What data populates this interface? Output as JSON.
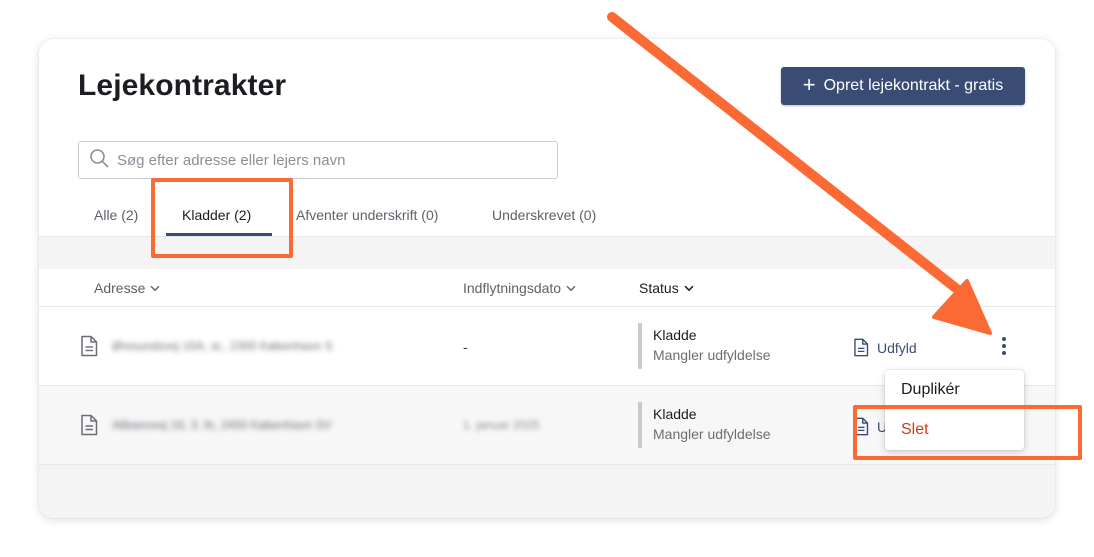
{
  "header": {
    "title": "Lejekontrakter",
    "create_button_label": "Opret lejekontrakt - gratis"
  },
  "search": {
    "placeholder": "Søg efter adresse eller lejers navn",
    "value": ""
  },
  "tabs": [
    {
      "label": "Alle (2)",
      "active": false
    },
    {
      "label": "Kladder (2)",
      "active": true
    },
    {
      "label": "Afventer underskrift (0)",
      "active": false
    },
    {
      "label": "Underskrevet (0)",
      "active": false
    }
  ],
  "table": {
    "columns": [
      {
        "label": "Adresse"
      },
      {
        "label": "Indflytningsdato"
      },
      {
        "label": "Status"
      }
    ],
    "rows": [
      {
        "address": "Øresundsvej 15A, st., 2300 København S",
        "move_in_date": "-",
        "status": "Kladde",
        "status_detail": "Mangler udfyldelse",
        "action_label": "Udfyld"
      },
      {
        "address": "Allbanovej 16, 3. th, 2450 København SV",
        "move_in_date": "1. januar 2025",
        "status": "Kladde",
        "status_detail": "Mangler udfyldelse",
        "action_label": "Udfyld"
      }
    ]
  },
  "row_menu": {
    "items": [
      {
        "label": "Duplikér"
      },
      {
        "label": "Slet"
      }
    ]
  },
  "colors": {
    "primary": "#3b4c74",
    "danger": "#d13b14",
    "annotation": "#fb6a35"
  }
}
